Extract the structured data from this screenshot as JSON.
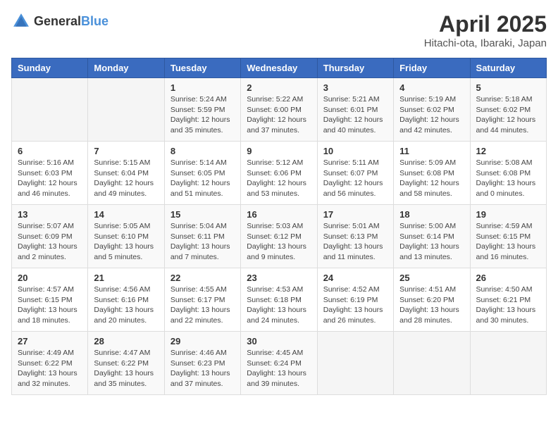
{
  "header": {
    "logo_general": "General",
    "logo_blue": "Blue",
    "month_year": "April 2025",
    "location": "Hitachi-ota, Ibaraki, Japan"
  },
  "weekdays": [
    "Sunday",
    "Monday",
    "Tuesday",
    "Wednesday",
    "Thursday",
    "Friday",
    "Saturday"
  ],
  "weeks": [
    [
      {
        "day": "",
        "detail": ""
      },
      {
        "day": "",
        "detail": ""
      },
      {
        "day": "1",
        "detail": "Sunrise: 5:24 AM\nSunset: 5:59 PM\nDaylight: 12 hours\nand 35 minutes."
      },
      {
        "day": "2",
        "detail": "Sunrise: 5:22 AM\nSunset: 6:00 PM\nDaylight: 12 hours\nand 37 minutes."
      },
      {
        "day": "3",
        "detail": "Sunrise: 5:21 AM\nSunset: 6:01 PM\nDaylight: 12 hours\nand 40 minutes."
      },
      {
        "day": "4",
        "detail": "Sunrise: 5:19 AM\nSunset: 6:02 PM\nDaylight: 12 hours\nand 42 minutes."
      },
      {
        "day": "5",
        "detail": "Sunrise: 5:18 AM\nSunset: 6:02 PM\nDaylight: 12 hours\nand 44 minutes."
      }
    ],
    [
      {
        "day": "6",
        "detail": "Sunrise: 5:16 AM\nSunset: 6:03 PM\nDaylight: 12 hours\nand 46 minutes."
      },
      {
        "day": "7",
        "detail": "Sunrise: 5:15 AM\nSunset: 6:04 PM\nDaylight: 12 hours\nand 49 minutes."
      },
      {
        "day": "8",
        "detail": "Sunrise: 5:14 AM\nSunset: 6:05 PM\nDaylight: 12 hours\nand 51 minutes."
      },
      {
        "day": "9",
        "detail": "Sunrise: 5:12 AM\nSunset: 6:06 PM\nDaylight: 12 hours\nand 53 minutes."
      },
      {
        "day": "10",
        "detail": "Sunrise: 5:11 AM\nSunset: 6:07 PM\nDaylight: 12 hours\nand 56 minutes."
      },
      {
        "day": "11",
        "detail": "Sunrise: 5:09 AM\nSunset: 6:08 PM\nDaylight: 12 hours\nand 58 minutes."
      },
      {
        "day": "12",
        "detail": "Sunrise: 5:08 AM\nSunset: 6:08 PM\nDaylight: 13 hours\nand 0 minutes."
      }
    ],
    [
      {
        "day": "13",
        "detail": "Sunrise: 5:07 AM\nSunset: 6:09 PM\nDaylight: 13 hours\nand 2 minutes."
      },
      {
        "day": "14",
        "detail": "Sunrise: 5:05 AM\nSunset: 6:10 PM\nDaylight: 13 hours\nand 5 minutes."
      },
      {
        "day": "15",
        "detail": "Sunrise: 5:04 AM\nSunset: 6:11 PM\nDaylight: 13 hours\nand 7 minutes."
      },
      {
        "day": "16",
        "detail": "Sunrise: 5:03 AM\nSunset: 6:12 PM\nDaylight: 13 hours\nand 9 minutes."
      },
      {
        "day": "17",
        "detail": "Sunrise: 5:01 AM\nSunset: 6:13 PM\nDaylight: 13 hours\nand 11 minutes."
      },
      {
        "day": "18",
        "detail": "Sunrise: 5:00 AM\nSunset: 6:14 PM\nDaylight: 13 hours\nand 13 minutes."
      },
      {
        "day": "19",
        "detail": "Sunrise: 4:59 AM\nSunset: 6:15 PM\nDaylight: 13 hours\nand 16 minutes."
      }
    ],
    [
      {
        "day": "20",
        "detail": "Sunrise: 4:57 AM\nSunset: 6:15 PM\nDaylight: 13 hours\nand 18 minutes."
      },
      {
        "day": "21",
        "detail": "Sunrise: 4:56 AM\nSunset: 6:16 PM\nDaylight: 13 hours\nand 20 minutes."
      },
      {
        "day": "22",
        "detail": "Sunrise: 4:55 AM\nSunset: 6:17 PM\nDaylight: 13 hours\nand 22 minutes."
      },
      {
        "day": "23",
        "detail": "Sunrise: 4:53 AM\nSunset: 6:18 PM\nDaylight: 13 hours\nand 24 minutes."
      },
      {
        "day": "24",
        "detail": "Sunrise: 4:52 AM\nSunset: 6:19 PM\nDaylight: 13 hours\nand 26 minutes."
      },
      {
        "day": "25",
        "detail": "Sunrise: 4:51 AM\nSunset: 6:20 PM\nDaylight: 13 hours\nand 28 minutes."
      },
      {
        "day": "26",
        "detail": "Sunrise: 4:50 AM\nSunset: 6:21 PM\nDaylight: 13 hours\nand 30 minutes."
      }
    ],
    [
      {
        "day": "27",
        "detail": "Sunrise: 4:49 AM\nSunset: 6:22 PM\nDaylight: 13 hours\nand 32 minutes."
      },
      {
        "day": "28",
        "detail": "Sunrise: 4:47 AM\nSunset: 6:22 PM\nDaylight: 13 hours\nand 35 minutes."
      },
      {
        "day": "29",
        "detail": "Sunrise: 4:46 AM\nSunset: 6:23 PM\nDaylight: 13 hours\nand 37 minutes."
      },
      {
        "day": "30",
        "detail": "Sunrise: 4:45 AM\nSunset: 6:24 PM\nDaylight: 13 hours\nand 39 minutes."
      },
      {
        "day": "",
        "detail": ""
      },
      {
        "day": "",
        "detail": ""
      },
      {
        "day": "",
        "detail": ""
      }
    ]
  ]
}
